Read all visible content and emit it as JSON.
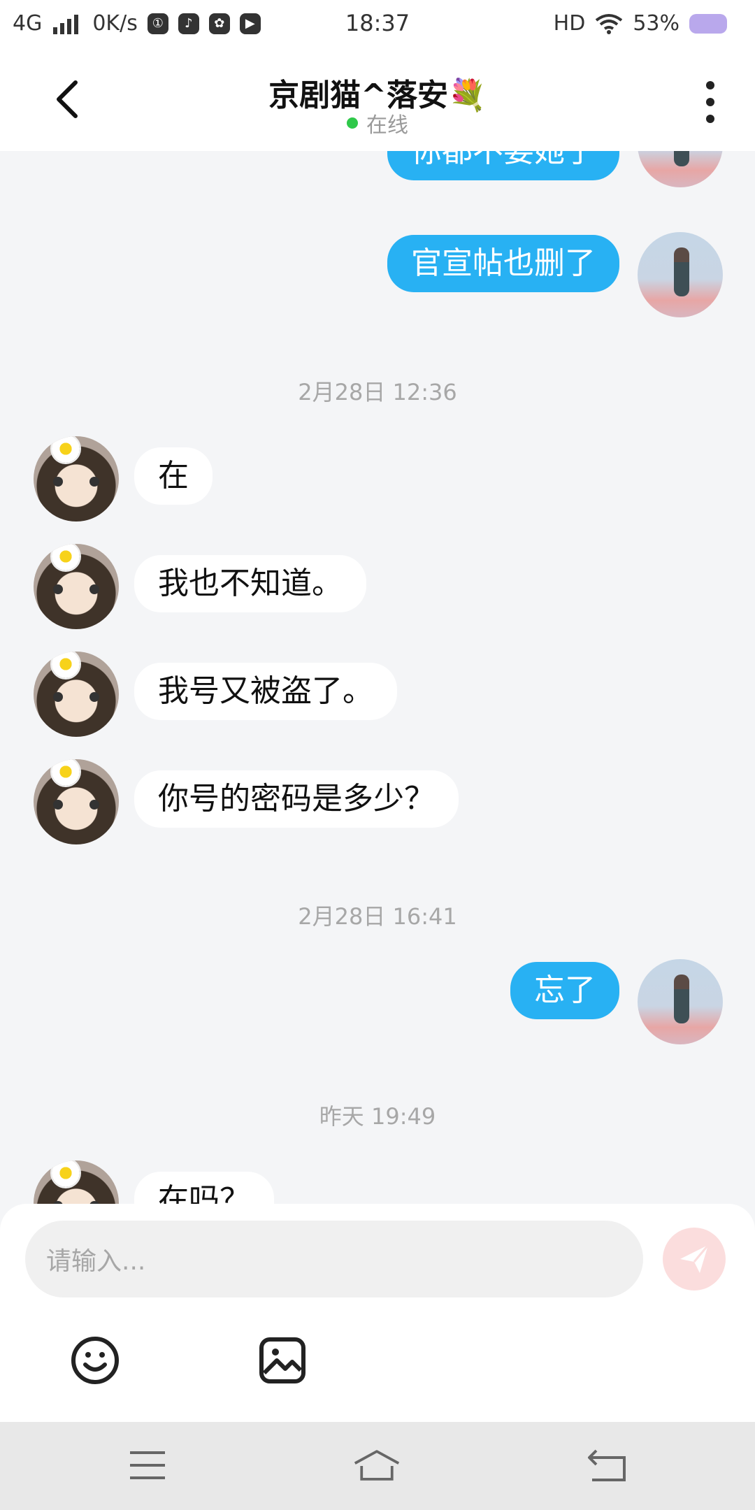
{
  "status_bar": {
    "network": "4G",
    "speed": "0K/s",
    "time": "18:37",
    "hd": "HD",
    "battery": "53%"
  },
  "header": {
    "title": "京剧猫^落安💐",
    "status": "在线"
  },
  "messages": [
    {
      "from": "me",
      "text": "你都不要她了"
    },
    {
      "from": "me",
      "text": "官宣帖也删了"
    },
    {
      "type": "time",
      "text": "2月28日 12:36"
    },
    {
      "from": "them",
      "text": "在"
    },
    {
      "from": "them",
      "text": "我也不知道。"
    },
    {
      "from": "them",
      "text": "我号又被盗了。"
    },
    {
      "from": "them",
      "text": "你号的密码是多少？"
    },
    {
      "type": "time",
      "text": "2月28日 16:41"
    },
    {
      "from": "me",
      "text": "忘了"
    },
    {
      "type": "time",
      "text": "昨天 19:49"
    },
    {
      "from": "them",
      "text": "在吗？"
    }
  ],
  "input": {
    "placeholder": "请输入..."
  },
  "icons": {
    "back": "back-arrow-icon",
    "more": "more-vertical-icon",
    "send": "send-icon",
    "emoji": "emoji-icon",
    "image": "image-icon",
    "menu": "menu-icon",
    "home": "home-icon",
    "return": "return-icon"
  },
  "colors": {
    "accent": "#28b1f3",
    "online": "#2fc84a",
    "background": "#f4f5f7",
    "send": "#f9c3c3"
  }
}
